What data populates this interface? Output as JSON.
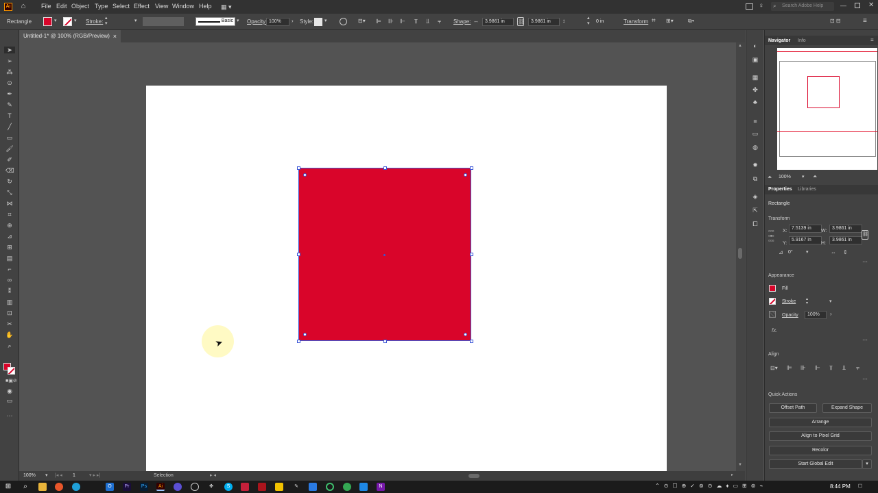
{
  "menubar": {
    "app_icon": "Ai",
    "home_icon": "home-icon",
    "items": [
      "File",
      "Edit",
      "Object",
      "Type",
      "Select",
      "Effect",
      "View",
      "Window",
      "Help"
    ],
    "search_placeholder": "Search Adobe Help"
  },
  "control_bar": {
    "object_type": "Rectangle",
    "stroke_label": "Stroke:",
    "brush_label": "Basic",
    "opacity_label": "Opacity:",
    "opacity_value": "100%",
    "style_label": "Style:",
    "shape_label": "Shape:",
    "shape_w": "3.9861 in",
    "shape_h": "3.9861 in",
    "corner_value": "0 in",
    "transform_label": "Transform"
  },
  "document": {
    "tab_title": "Untitled-1* @ 100% (RGB/Preview)",
    "close_icon": "×"
  },
  "status_bar": {
    "zoom": "100%",
    "artboard_index": "1",
    "tool_name": "Selection"
  },
  "navigator": {
    "tabs": [
      "Navigator",
      "Info"
    ],
    "zoom": "100%"
  },
  "properties": {
    "tabs": [
      "Properties",
      "Libraries"
    ],
    "object_type": "Rectangle",
    "transform": {
      "title": "Transform",
      "x_label": "X:",
      "x": "7.5139 in",
      "y_label": "Y:",
      "y": "5.9167 in",
      "w_label": "W:",
      "w": "3.9861 in",
      "h_label": "H:",
      "h": "3.9861 in",
      "rotate": "0°"
    },
    "appearance": {
      "title": "Appearance",
      "fill_label": "Fill",
      "stroke_label": "Stroke",
      "opacity_label": "Opacity",
      "opacity_value": "100%",
      "fx_label": "fx."
    },
    "align": {
      "title": "Align"
    },
    "quick_actions": {
      "title": "Quick Actions",
      "offset_path": "Offset Path",
      "expand_shape": "Expand Shape",
      "arrange": "Arrange",
      "align_pixel": "Align to Pixel Grid",
      "recolor": "Recolor",
      "global_edit": "Start Global Edit"
    }
  },
  "colors": {
    "fill": "#d9052a",
    "selection": "#3a55d6",
    "ui_dark": "#323232",
    "panel": "#424242"
  },
  "taskbar": {
    "time": "8:44 PM"
  }
}
